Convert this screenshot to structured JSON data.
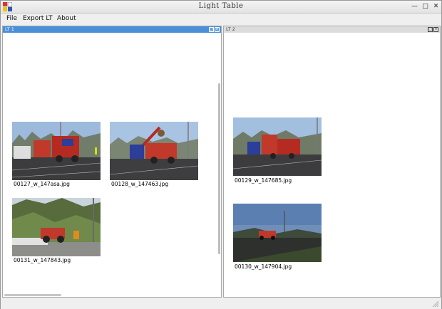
{
  "window": {
    "title": "Light Table"
  },
  "menu": [
    "File",
    "Export LT",
    "About"
  ],
  "panes": [
    {
      "title": "LT 1",
      "active": true,
      "images": [
        {
          "file": "00127_w_147asa.jpg",
          "scene": "harvest"
        },
        {
          "file": "00128_w_147463.jpg",
          "scene": "crane"
        },
        {
          "file": "00131_w_147843.jpg",
          "scene": "trees"
        }
      ]
    },
    {
      "title": "LT 2",
      "active": false,
      "images": [
        {
          "file": "00129_w_147685.jpg",
          "scene": "harvest"
        },
        {
          "file": "00130_w_147904.jpg",
          "scene": "dusk"
        }
      ]
    }
  ],
  "colors": {
    "active_header": "#4a90d9",
    "inactive_header": "#dcdcdc",
    "machine_red": "#c0392b"
  }
}
